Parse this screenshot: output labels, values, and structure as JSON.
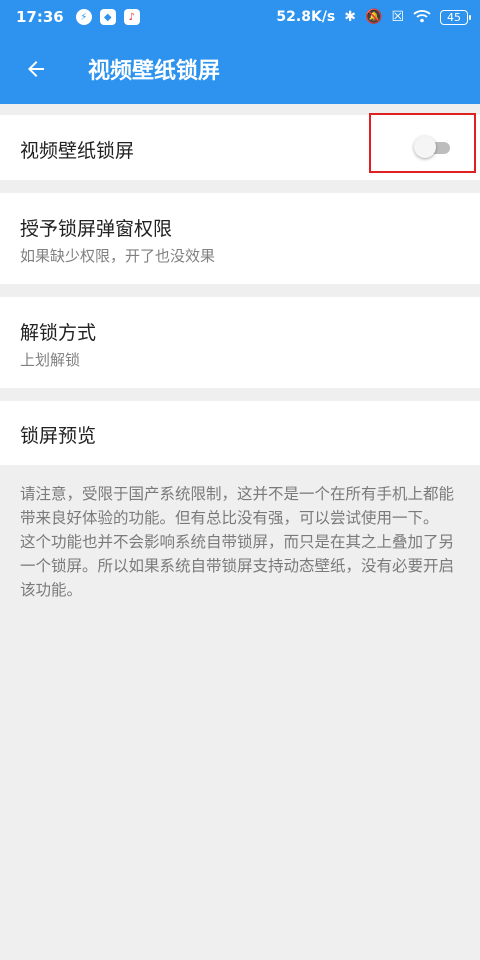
{
  "status_bar": {
    "time": "17:36",
    "net_speed": "52.8K/s",
    "battery": "45"
  },
  "toolbar": {
    "title": "视频壁纸锁屏"
  },
  "settings": [
    {
      "title": "视频壁纸锁屏",
      "enabled": false
    },
    {
      "title": "授予锁屏弹窗权限",
      "subtitle": "如果缺少权限，开了也没效果"
    },
    {
      "title": "解锁方式",
      "subtitle": "上划解锁"
    },
    {
      "title": "锁屏预览"
    }
  ],
  "note": {
    "paragraph_1": "请注意，受限于国产系统限制，这并不是一个在所有手机上都能带来良好体验的功能。但有总比没有强，可以尝试使用一下。",
    "paragraph_2": "这个功能也并不会影响系统自带锁屏，而只是在其之上叠加了另一个锁屏。所以如果系统自带锁屏支持动态壁纸，没有必要开启该功能。"
  },
  "colors": {
    "app_bar": "#2d93ee",
    "highlight": "#e02020"
  }
}
